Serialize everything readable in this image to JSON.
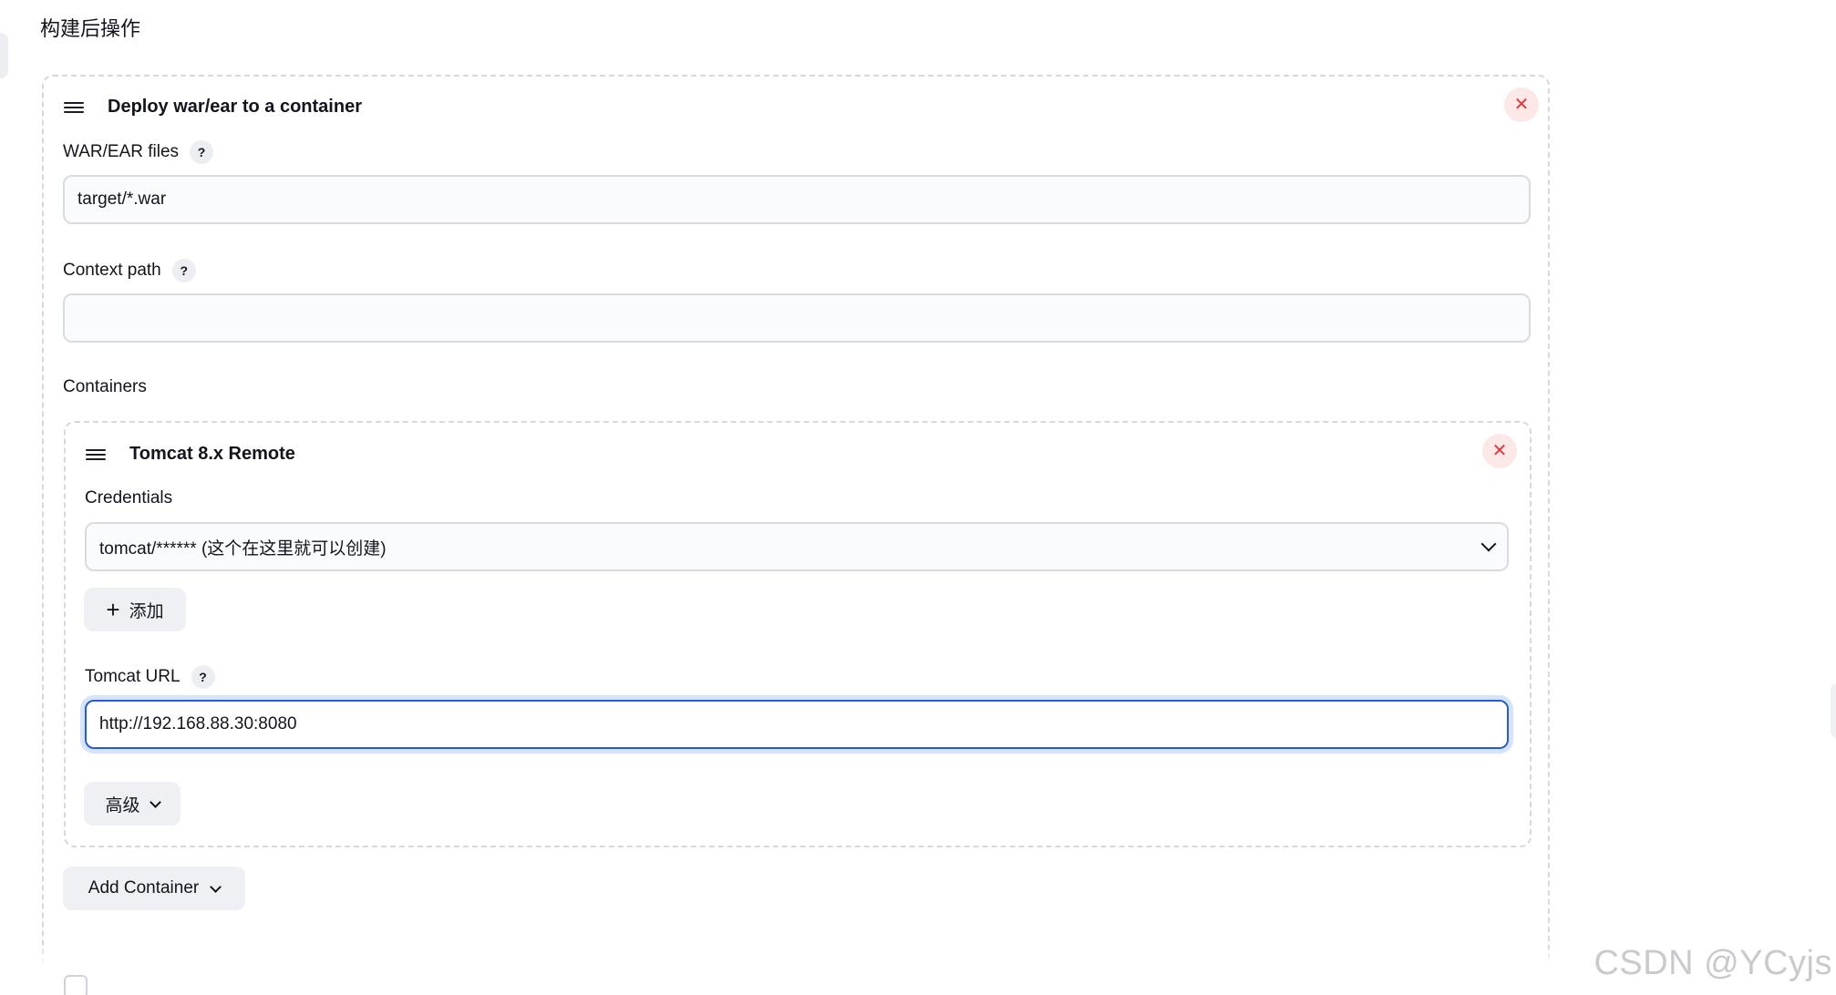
{
  "section": {
    "title": "构建后操作"
  },
  "deploy_card": {
    "title": "Deploy war/ear to a container",
    "close_symbol": "✕",
    "war_files": {
      "label": "WAR/EAR files",
      "help": "?",
      "value": "target/*.war"
    },
    "context_path": {
      "label": "Context path",
      "help": "?",
      "value": ""
    },
    "containers_label": "Containers",
    "add_container_label": "Add Container"
  },
  "container_card": {
    "title": "Tomcat 8.x Remote",
    "close_symbol": "✕",
    "credentials": {
      "label": "Credentials",
      "selected": "tomcat/****** (这个在这里就可以创建)",
      "add_label": "添加",
      "add_symbol": "+"
    },
    "tomcat_url": {
      "label": "Tomcat URL",
      "help": "?",
      "value": "http://192.168.88.30:8080"
    },
    "advanced_label": "高级"
  },
  "watermark": "CSDN @YCyjs",
  "colors": {
    "focus_border": "#2a5cc7",
    "close_red": "#e0393e",
    "close_bg": "#fde8e8",
    "soft_button_bg": "#eef0f3"
  },
  "icons": [
    "drag-handle-icon",
    "close-icon",
    "help-icon",
    "chevron-down-icon",
    "plus-icon"
  ]
}
